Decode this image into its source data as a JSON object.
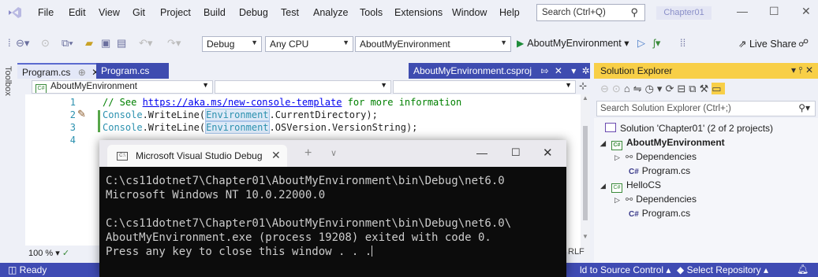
{
  "menubar": {
    "items": [
      "File",
      "Edit",
      "View",
      "Git",
      "Project",
      "Build",
      "Debug",
      "Test",
      "Analyze",
      "Tools",
      "Extensions",
      "Window",
      "Help"
    ],
    "search_placeholder": "Search (Ctrl+Q)",
    "solution_name": "Chapter01"
  },
  "toolbar": {
    "configuration": "Debug",
    "platform": "Any CPU",
    "startup_project": "AboutMyEnvironment",
    "run_target": "AboutMyEnvironment",
    "live_share": "Live Share"
  },
  "toolbox": {
    "label": "Toolbox"
  },
  "editor": {
    "tabs": [
      {
        "label": "Program.cs",
        "pinned_icon": "⊕",
        "close": "✕"
      },
      {
        "label": "Program.cs"
      },
      {
        "label": "AboutMyEnvironment.csproj"
      }
    ],
    "nav_project": "AboutMyEnvironment",
    "zoom": "100 %",
    "line_ending": "RLF",
    "lines": [
      {
        "num": "1",
        "comment_prefix": "// See ",
        "link": "https://aka.ms/new-console-template",
        "comment_suffix": " for more information"
      },
      {
        "num": "2",
        "console": "Console",
        "method": ".WriteLine(",
        "env": "Environment",
        "rest": ".CurrentDirectory);"
      },
      {
        "num": "3",
        "console": "Console",
        "method": ".WriteLine(",
        "env": "Environment",
        "rest": ".OSVersion.VersionString);"
      },
      {
        "num": "4"
      }
    ]
  },
  "solution_explorer": {
    "title": "Solution Explorer",
    "search_placeholder": "Search Solution Explorer (Ctrl+;)",
    "solution_label": "Solution 'Chapter01' (2 of 2 projects)",
    "projects": [
      {
        "name": "AboutMyEnvironment",
        "dependencies": "Dependencies",
        "file": "Program.cs"
      },
      {
        "name": "HelloCS",
        "dependencies": "Dependencies",
        "file": "Program.cs"
      }
    ]
  },
  "statusbar": {
    "ready": "Ready",
    "source_control": "ld to Source Control",
    "repository": "Select Repository"
  },
  "console": {
    "tab_title": "Microsoft Visual Studio Debug C",
    "lines": [
      "C:\\cs11dotnet7\\Chapter01\\AboutMyEnvironment\\bin\\Debug\\net6.0",
      "Microsoft Windows NT 10.0.22000.0",
      "",
      "C:\\cs11dotnet7\\Chapter01\\AboutMyEnvironment\\bin\\Debug\\net6.0\\",
      "AboutMyEnvironment.exe (process 19208) exited with code 0.",
      "Press any key to close this window . . ."
    ]
  },
  "colors": {
    "accent": "#3f4bb3",
    "solution_explorer_title": "#f8cf47",
    "console_bg": "#0c0c0c",
    "comment": "#008000",
    "type": "#2b91af"
  }
}
